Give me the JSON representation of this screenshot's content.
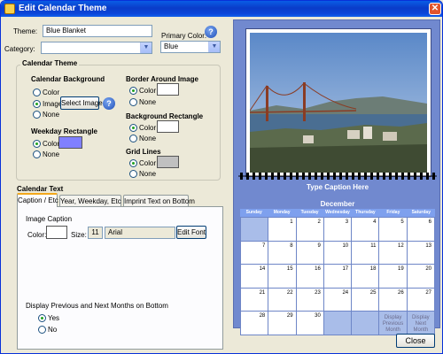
{
  "window": {
    "title": "Edit Calendar Theme"
  },
  "theme": {
    "label": "Theme:",
    "value": "Blue Blanket"
  },
  "category": {
    "label": "Category:",
    "value": ""
  },
  "primary_color": {
    "label": "Primary Color:",
    "value": "Blue"
  },
  "calendar_theme": {
    "title": "Calendar Theme",
    "background": {
      "title": "Calendar Background",
      "options": [
        "Color",
        "Image",
        "None"
      ],
      "selected": "Image",
      "select_image_label": "Select Image"
    },
    "border": {
      "title": "Border Around Image",
      "options": [
        "Color",
        "None"
      ],
      "selected": "Color",
      "color": "#ffffff"
    },
    "background_rect": {
      "title": "Background Rectangle",
      "options": [
        "Color",
        "None"
      ],
      "selected": "Color",
      "color": "#ffffff"
    },
    "weekday_rect": {
      "title": "Weekday Rectangle",
      "options": [
        "Color",
        "None"
      ],
      "selected": "Color",
      "color": "#8080ff"
    },
    "grid_lines": {
      "title": "Grid Lines",
      "options": [
        "Color",
        "None"
      ],
      "selected": "Color",
      "color": "#c0c0c0"
    }
  },
  "calendar_text": {
    "title": "Calendar Text",
    "tabs": [
      "Caption / Etc",
      "Year, Weekday, Etc",
      "Imprint Text on Bottom"
    ],
    "active_tab": "Caption / Etc",
    "image_caption": {
      "title": "Image Caption",
      "color_label": "Color:",
      "size_label": "Size:",
      "size": "11",
      "font": "Arial",
      "edit_font_label": "Edit Font"
    },
    "display_months": {
      "title": "Display Previous and Next Months on Bottom",
      "options": [
        "Yes",
        "No"
      ],
      "selected": "Yes"
    }
  },
  "preview": {
    "caption": "Type Caption Here",
    "month": "December",
    "weekdays": [
      "Sunday",
      "Monday",
      "Tuesday",
      "Wednesday",
      "Thursday",
      "Friday",
      "Saturday"
    ],
    "rows": [
      [
        "",
        "1",
        "2",
        "3",
        "4",
        "5",
        "6"
      ],
      [
        "7",
        "8",
        "9",
        "10",
        "11",
        "12",
        "13"
      ],
      [
        "14",
        "15",
        "16",
        "17",
        "18",
        "19",
        "20"
      ],
      [
        "21",
        "22",
        "23",
        "24",
        "25",
        "26",
        "27"
      ],
      [
        "28",
        "29",
        "30",
        "",
        "",
        "Display Previous Month",
        "Display Next Month"
      ]
    ]
  },
  "close_label": "Close",
  "colors": {
    "accent": "#0a3cc9",
    "preview_bg": "#7189cf",
    "weekday_header": "#7ea0ee"
  }
}
